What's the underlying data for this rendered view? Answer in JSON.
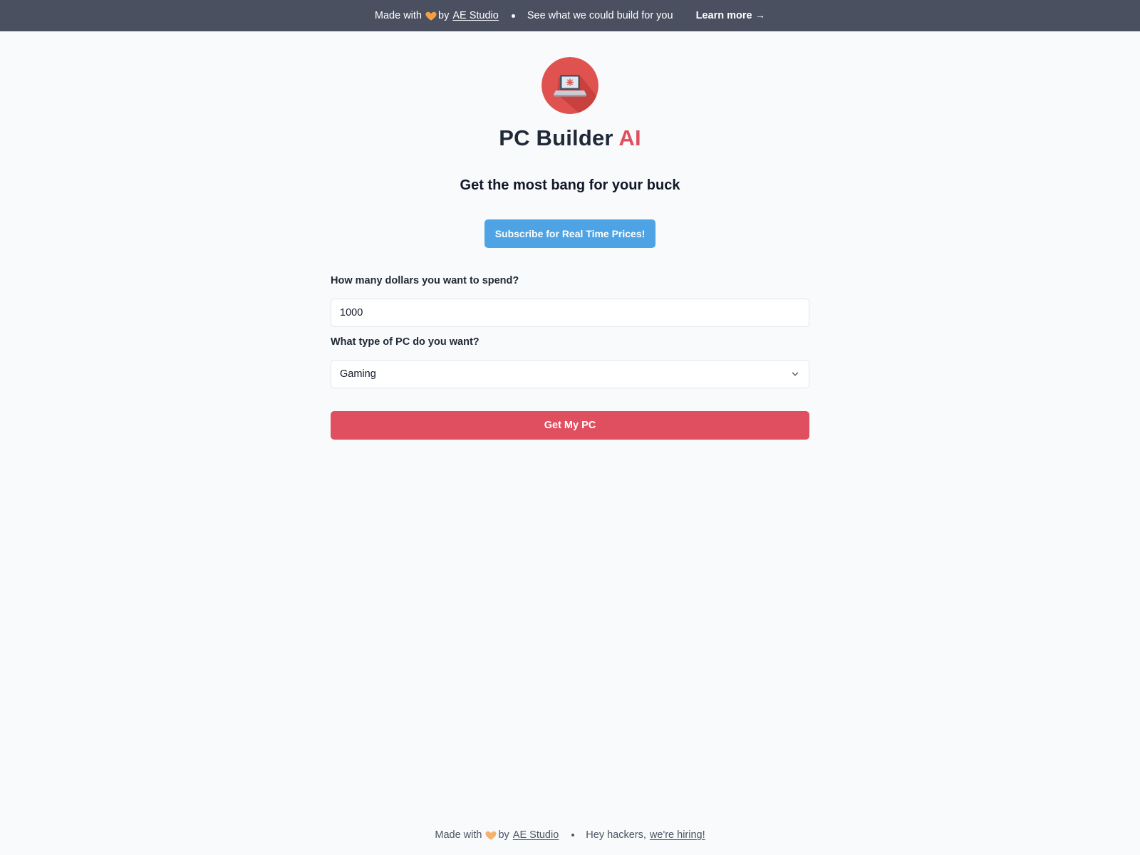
{
  "banner": {
    "made_with": "Made with",
    "by": "by",
    "studio_link": "AE Studio",
    "pitch": "See what we could build for you",
    "learn_more": "Learn more →"
  },
  "header": {
    "logo_icon": "laptop-icon",
    "title_main": "PC Builder",
    "title_accent": "AI",
    "tagline": "Get the most bang for your buck"
  },
  "subscribe_label": "Subscribe for Real Time Prices!",
  "form": {
    "budget_label": "How many dollars you want to spend?",
    "budget_value": "1000",
    "type_label": "What type of PC do you want?",
    "type_value": "Gaming",
    "submit_label": "Get My PC"
  },
  "footer": {
    "made_with": "Made with",
    "by": "by",
    "studio_link": "AE Studio",
    "hackers": "Hey hackers,",
    "hiring_link": "we're hiring!"
  },
  "colors": {
    "banner_bg": "#4a5060",
    "accent_red": "#e04f60",
    "subscribe_blue": "#4ea3e4",
    "page_bg": "#f8fafc",
    "heart": "#f59e42"
  }
}
